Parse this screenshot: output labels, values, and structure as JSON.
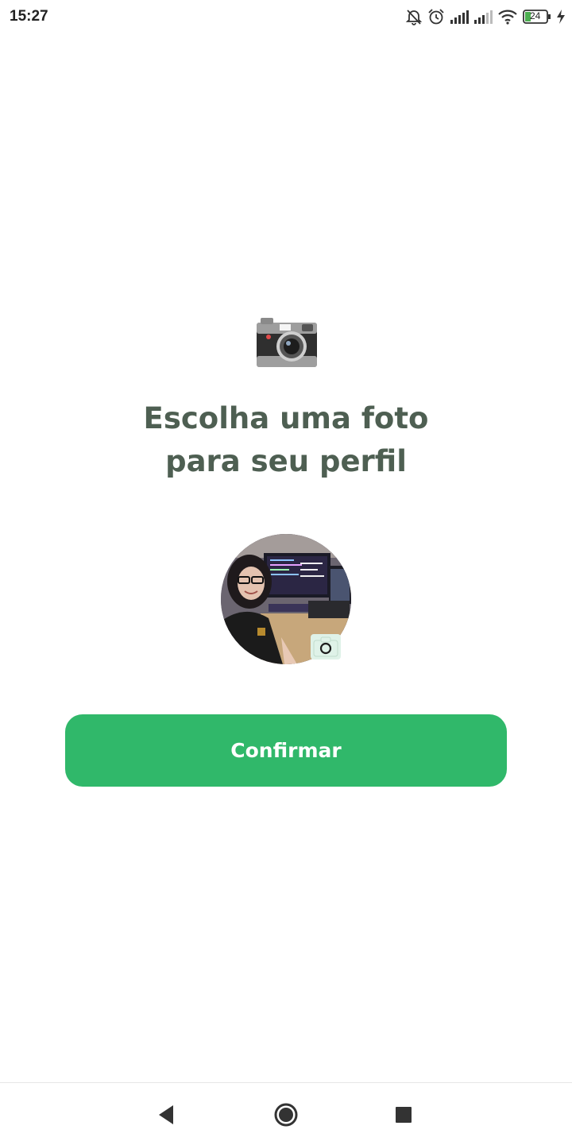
{
  "status_bar": {
    "time": "15:27",
    "battery_level": "24",
    "icons": [
      "bell-off-icon",
      "alarm-icon",
      "signal-icon",
      "signal-icon",
      "wifi-icon",
      "battery-icon",
      "charging-icon"
    ]
  },
  "main": {
    "hero_icon": "camera-emoji-icon",
    "title_line1": "Escolha uma foto",
    "title_line2": "para seu perfil",
    "avatar": "profile-photo",
    "avatar_badge_icon": "camera-icon",
    "confirm_label": "Confirmar"
  },
  "nav_bar": {
    "buttons": [
      "back-icon",
      "home-icon",
      "recents-icon"
    ]
  },
  "colors": {
    "title": "#4e5f52",
    "button": "#30b86a",
    "badge": "#dff2e8"
  }
}
